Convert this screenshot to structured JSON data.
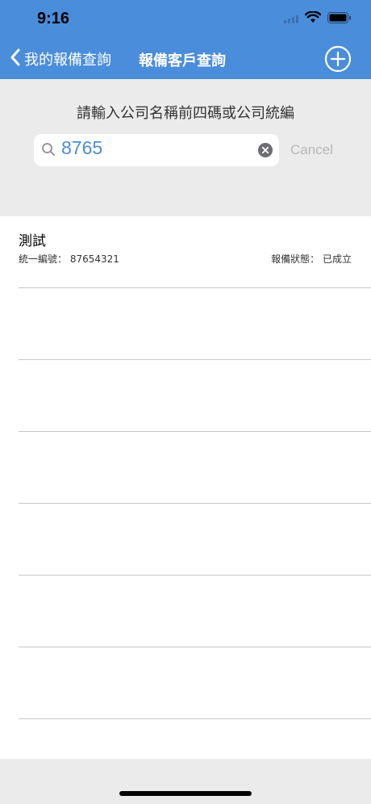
{
  "status_bar": {
    "time": "9:16"
  },
  "nav": {
    "back_label": "我的報備查詢",
    "title": "報備客戶查詢",
    "add_icon": "plus-circle-icon"
  },
  "search": {
    "prompt": "請輸入公司名稱前四碼或公司統編",
    "value": "8765",
    "cancel_label": "Cancel"
  },
  "results": [
    {
      "name": "測試",
      "id_label": "統一編號：",
      "id_value": "87654321",
      "status_label": "報備狀態：",
      "status_value": "已成立"
    }
  ],
  "colors": {
    "accent": "#4a8ddb",
    "background": "#ebebeb"
  }
}
